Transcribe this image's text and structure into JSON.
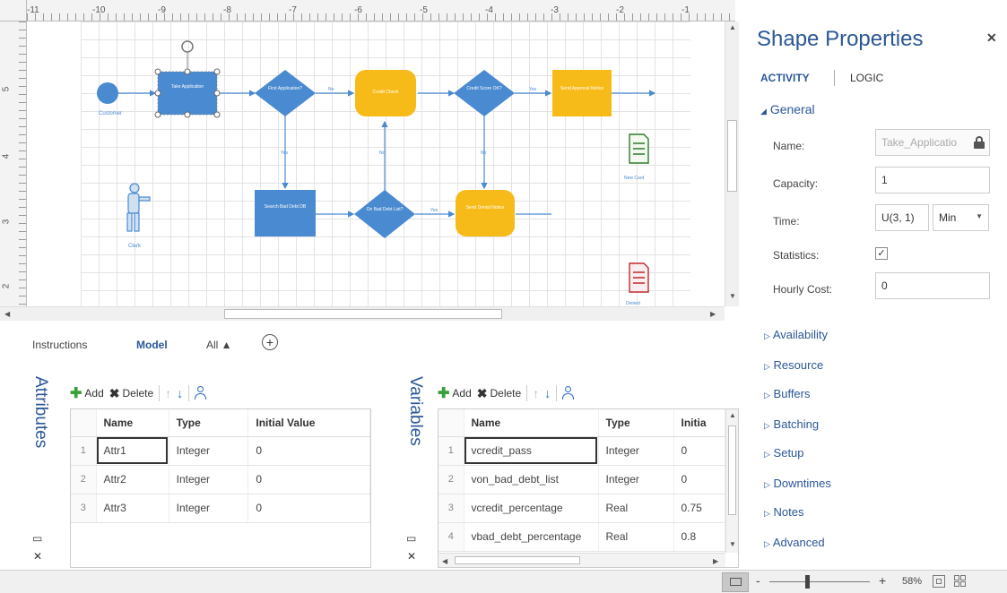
{
  "ruler": {
    "h_ticks": [
      "-11",
      "-10",
      "-9",
      "-8",
      "-7",
      "-6",
      "-5",
      "-4",
      "-3",
      "-2",
      "-1"
    ],
    "v_ticks": [
      "5",
      "4",
      "3",
      "2"
    ]
  },
  "diagram": {
    "nodes": {
      "customer": "Customer",
      "take_application": "Take Application",
      "first_application": "First Application?",
      "credit_check": "Credit Check",
      "credit_score": "Credit Score OK?",
      "send_approval": "Send Approval Notice",
      "search_bad_debt": "Search Bad Debt DB",
      "on_bad_debt": "On Bad Debt List?",
      "send_denial": "Send Denial Notice",
      "clerk": "Clerk",
      "new_card": "New Card",
      "denied": "Denied"
    },
    "edge_labels": {
      "yes": "Yes",
      "no": "No"
    }
  },
  "properties": {
    "title": "Shape Properties",
    "tabs": [
      "ACTIVITY",
      "LOGIC"
    ],
    "general_label": "General",
    "fields": {
      "name_label": "Name:",
      "name_value": "Take_Applicatio",
      "capacity_label": "Capacity:",
      "capacity_value": "1",
      "time_label": "Time:",
      "time_value": "U(3, 1)",
      "time_unit": "Min",
      "statistics_label": "Statistics:",
      "statistics_checked": "✓",
      "hourly_cost_label": "Hourly Cost:",
      "hourly_cost_value": "0"
    },
    "sections": [
      "Availability",
      "Resource",
      "Buffers",
      "Batching",
      "Setup",
      "Downtimes",
      "Notes",
      "Advanced"
    ]
  },
  "model_tabs": {
    "instructions": "Instructions",
    "model": "Model",
    "all": "All ▲"
  },
  "attributes": {
    "title": "Attributes",
    "toolbar": {
      "add": "Add",
      "delete": "Delete"
    },
    "columns": [
      "Name",
      "Type",
      "Initial Value"
    ],
    "rows": [
      {
        "n": "1",
        "name": "Attr1",
        "type": "Integer",
        "value": "0"
      },
      {
        "n": "2",
        "name": "Attr2",
        "type": "Integer",
        "value": "0"
      },
      {
        "n": "3",
        "name": "Attr3",
        "type": "Integer",
        "value": "0"
      }
    ]
  },
  "variables": {
    "title": "Variables",
    "toolbar": {
      "add": "Add",
      "delete": "Delete"
    },
    "columns": [
      "Name",
      "Type",
      "Initia"
    ],
    "rows": [
      {
        "n": "1",
        "name": "vcredit_pass",
        "type": "Integer",
        "value": "0"
      },
      {
        "n": "2",
        "name": "von_bad_debt_list",
        "type": "Integer",
        "value": "0"
      },
      {
        "n": "3",
        "name": "vcredit_percentage",
        "type": "Real",
        "value": "0.75"
      },
      {
        "n": "4",
        "name": "vbad_debt_percentage",
        "type": "Real",
        "value": "0.8"
      }
    ]
  },
  "statusbar": {
    "zoom_minus": "-",
    "zoom_plus": "+",
    "zoom_level": "58%",
    "zoom_fraction": 0.36
  },
  "colors": {
    "activity_blue": "#4a8ad0",
    "decision_blue": "#4a8ad0",
    "task_yellow": "#f6bb19",
    "accent": "#2b5797"
  }
}
